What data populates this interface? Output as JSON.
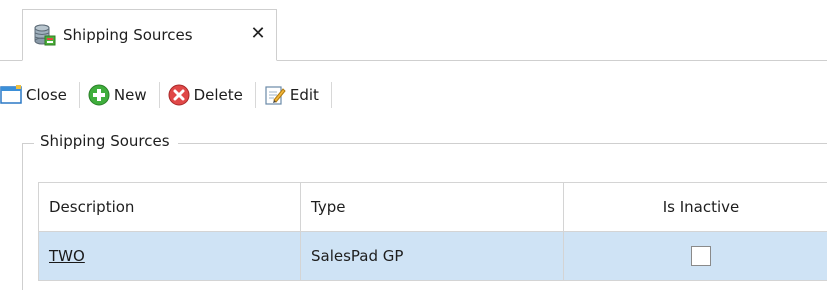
{
  "tab": {
    "title": "Shipping Sources",
    "close_glyph": "✕"
  },
  "toolbar": {
    "close_label": "Close",
    "new_label": "New",
    "delete_label": "Delete",
    "edit_label": "Edit"
  },
  "group": {
    "title": "Shipping Sources"
  },
  "grid": {
    "columns": [
      "Description",
      "Type",
      "Is Inactive"
    ],
    "rows": [
      {
        "description": "TWO",
        "type": "SalesPad GP",
        "is_inactive": false
      }
    ]
  },
  "colors": {
    "selected_row": "#cfe3f5",
    "border": "#d4d4d4"
  }
}
